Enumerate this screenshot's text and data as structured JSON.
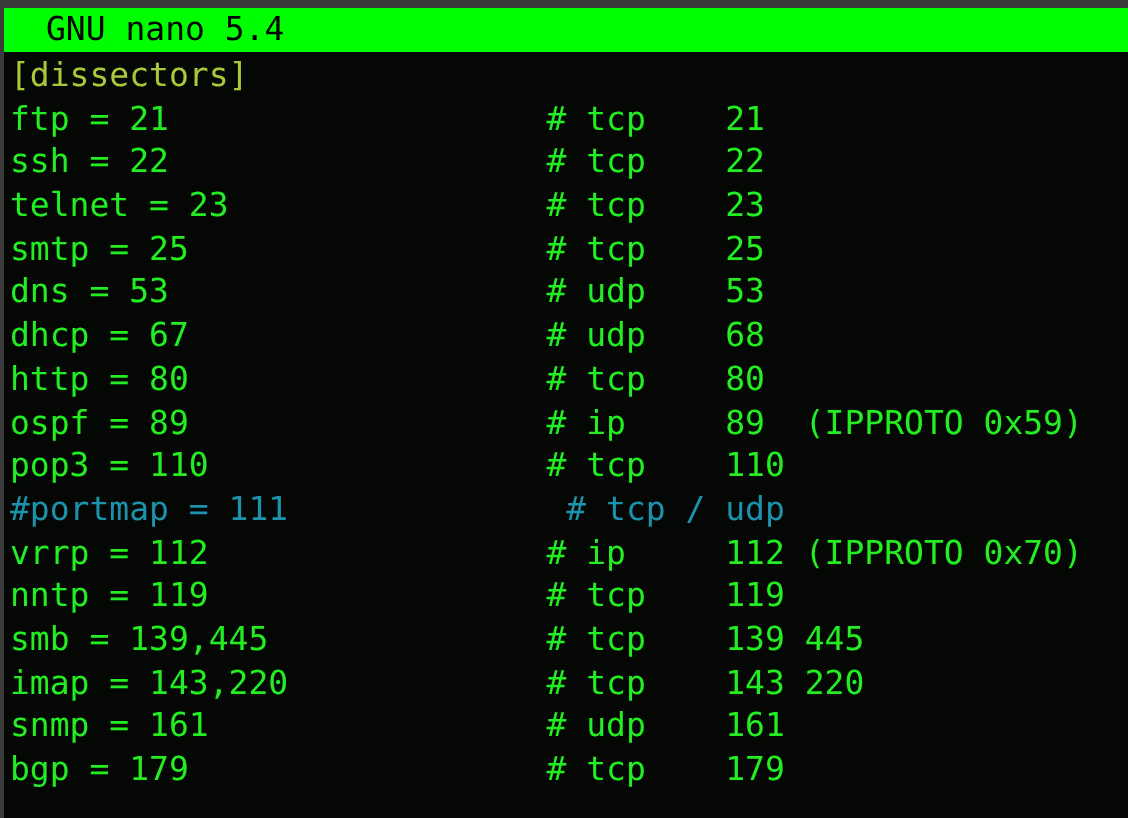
{
  "window": {
    "title": "GNU nano 5.4"
  },
  "lines": [
    {
      "kind": "section",
      "text": "[dissectors]"
    },
    {
      "kind": "entry",
      "text": "ftp = 21                   # tcp    21"
    },
    {
      "kind": "entry",
      "text": "ssh = 22                   # tcp    22"
    },
    {
      "kind": "entry",
      "text": "telnet = 23                # tcp    23"
    },
    {
      "kind": "entry",
      "text": "smtp = 25                  # tcp    25"
    },
    {
      "kind": "entry",
      "text": "dns = 53                   # udp    53"
    },
    {
      "kind": "entry",
      "text": "dhcp = 67                  # udp    68"
    },
    {
      "kind": "entry",
      "text": "http = 80                  # tcp    80"
    },
    {
      "kind": "entry",
      "text": "ospf = 89                  # ip     89  (IPPROTO 0x59)"
    },
    {
      "kind": "entry",
      "text": "pop3 = 110                 # tcp    110"
    },
    {
      "kind": "comment",
      "text": "#portmap = 111              # tcp / udp"
    },
    {
      "kind": "entry",
      "text": "vrrp = 112                 # ip     112 (IPPROTO 0x70)"
    },
    {
      "kind": "entry",
      "text": "nntp = 119                 # tcp    119"
    },
    {
      "kind": "entry",
      "text": "smb = 139,445              # tcp    139 445"
    },
    {
      "kind": "entry",
      "text": "imap = 143,220             # tcp    143 220"
    },
    {
      "kind": "entry",
      "text": "snmp = 161                 # udp    161"
    },
    {
      "kind": "entry",
      "text": "bgp = 179                  # tcp    179"
    }
  ]
}
